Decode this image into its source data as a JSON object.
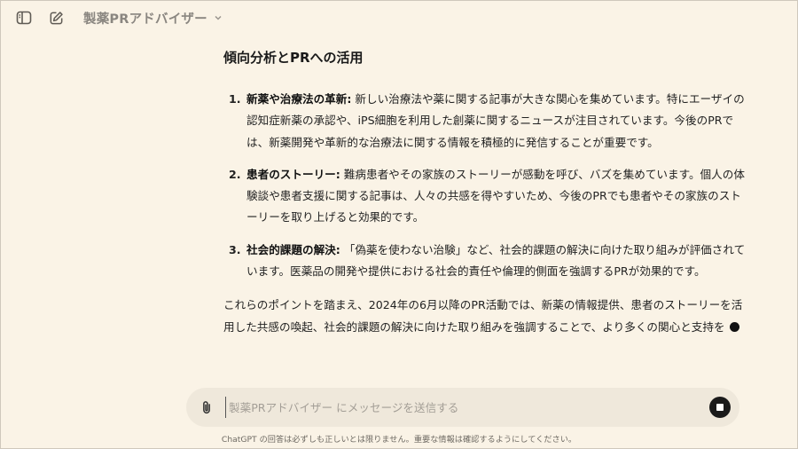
{
  "header": {
    "model_name": "製薬PRアドバイザー"
  },
  "response": {
    "heading": "傾向分析とPRへの活用",
    "items": [
      {
        "number": "1.",
        "term": "新薬や治療法の革新:",
        "text": " 新しい治療法や薬に関する記事が大きな関心を集めています。特にエーザイの認知症新薬の承認や、iPS細胞を利用した創薬に関するニュースが注目されています。今後のPRでは、新薬開発や革新的な治療法に関する情報を積極的に発信することが重要です。"
      },
      {
        "number": "2.",
        "term": "患者のストーリー:",
        "text": " 難病患者やその家族のストーリーが感動を呼び、バズを集めています。個人の体験談や患者支援に関する記事は、人々の共感を得やすいため、今後のPRでも患者やその家族のストーリーを取り上げると効果的です。"
      },
      {
        "number": "3.",
        "term": "社会的課題の解決:",
        "text": " 「偽薬を使わない治験」など、社会的課題の解決に向けた取り組みが評価されています。医薬品の開発や提供における社会的責任や倫理的側面を強調するPRが効果的です。"
      }
    ],
    "summary": "これらのポイントを踏まえ、2024年の6月以降のPR活動では、新薬の情報提供、患者のストーリーを活用した共感の喚起、社会的課題の解決に向けた取り組みを強調することで、より多くの関心と支持を"
  },
  "composer": {
    "placeholder": "製薬PRアドバイザー にメッセージを送信する",
    "value": ""
  },
  "footer": {
    "disclaimer": "ChatGPT の回答は必ずしも正しいとは限りません。重要な情報は確認するようにしてください。"
  },
  "icons": {
    "sidebar": "sidebar-toggle-icon",
    "new_chat": "edit-icon",
    "chevron": "chevron-down-icon",
    "attach": "paperclip-icon",
    "stop": "stop-icon"
  }
}
